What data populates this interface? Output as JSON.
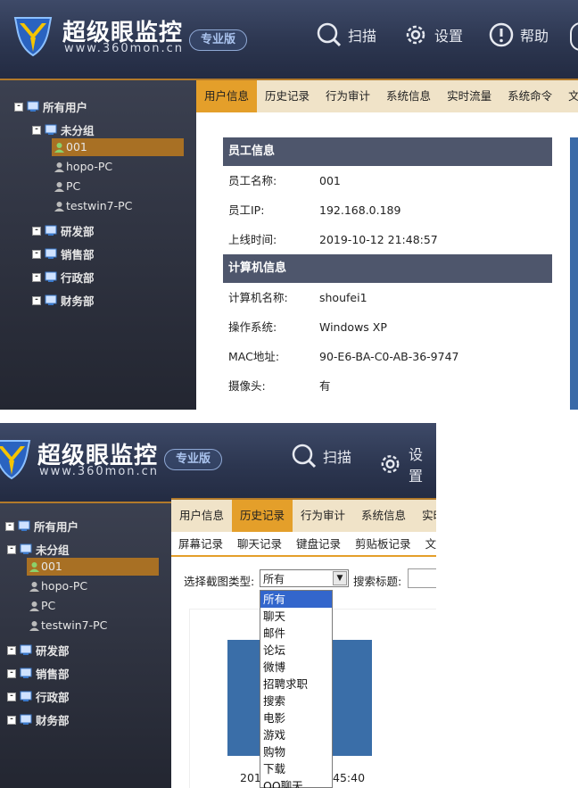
{
  "app": {
    "title": "超级眼监控",
    "url": "www.360mon.cn",
    "edition": "专业版",
    "header_buttons": [
      {
        "label": "扫描",
        "icon": "search-icon"
      },
      {
        "label": "设置",
        "icon": "gear-icon"
      },
      {
        "label": "帮助",
        "icon": "help-icon"
      }
    ],
    "header_buttons_p2": [
      {
        "label": "扫描",
        "icon": "search-icon"
      },
      {
        "label": "设置",
        "icon": "gear-icon"
      }
    ]
  },
  "tree": {
    "root": "所有用户",
    "group_ungrouped": "未分组",
    "users": [
      "001",
      "hopo-PC",
      "PC",
      "testwin7-PC"
    ],
    "selected_user": "001",
    "groups": [
      "研发部",
      "销售部",
      "行政部",
      "财务部"
    ]
  },
  "tabs_p1": [
    "用户信息",
    "历史记录",
    "行为审计",
    "系统信息",
    "实时流量",
    "系统命令",
    "文"
  ],
  "tabs_p2": [
    "用户信息",
    "历史记录",
    "行为审计",
    "系统信息",
    "实时"
  ],
  "employee_info": {
    "section_title": "员工信息",
    "rows": [
      {
        "key": "员工名称:",
        "value": "001"
      },
      {
        "key": "员工IP:",
        "value": "192.168.0.189"
      },
      {
        "key": "上线时间:",
        "value": "2019-10-12 21:48:57"
      }
    ]
  },
  "computer_info": {
    "section_title": "计算机信息",
    "rows": [
      {
        "key": "计算机名称:",
        "value": "shoufei1"
      },
      {
        "key": "操作系统:",
        "value": "Windows XP"
      },
      {
        "key": "MAC地址:",
        "value": "90-E6-BA-C0-AB-36-9747"
      },
      {
        "key": "摄像头:",
        "value": "有"
      }
    ]
  },
  "history": {
    "subtabs": [
      "屏幕记录",
      "聊天记录",
      "键盘记录",
      "剪贴板记录",
      "文"
    ],
    "active_subtab": "屏幕记录",
    "filter_label": "选择截图类型:",
    "filter_value": "所有",
    "search_label": "搜索标题:",
    "options": [
      "所有",
      "聊天",
      "邮件",
      "论坛",
      "微博",
      "招聘求职",
      "搜索",
      "电影",
      "游戏",
      "购物",
      "下载",
      "QQ聊天"
    ],
    "thumb_caption_left": "201",
    "thumb_caption_right": "45:40"
  },
  "colors": {
    "accent_orange": "#e49f2a",
    "selected_tree": "#a87024",
    "section_head": "#4e566c",
    "dropdown_highlight": "#3366cc"
  }
}
